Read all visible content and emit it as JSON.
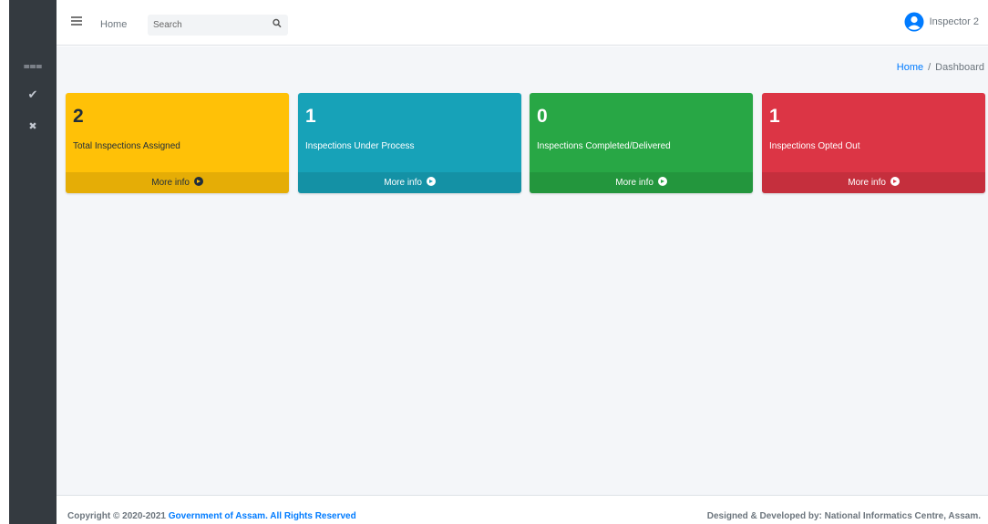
{
  "sidebar": {
    "items": [
      {
        "icon": "tasks-icon",
        "glyph": "⩶"
      },
      {
        "icon": "check-icon",
        "glyph": "✔"
      },
      {
        "icon": "times-icon",
        "glyph": "✖"
      }
    ]
  },
  "topbar": {
    "home_label": "Home",
    "search_placeholder": "Search",
    "user_name": "Inspector 2"
  },
  "breadcrumb": {
    "home": "Home",
    "separator": "/",
    "current": "Dashboard"
  },
  "cards": [
    {
      "value": "2",
      "label": "Total Inspections Assigned",
      "more": "More info",
      "color": "#ffc107"
    },
    {
      "value": "1",
      "label": "Inspections Under Process",
      "more": "More info",
      "color": "#17a2b8"
    },
    {
      "value": "0",
      "label": "Inspections Completed/Delivered",
      "more": "More info",
      "color": "#28a745"
    },
    {
      "value": "1",
      "label": "Inspections Opted Out",
      "more": "More info",
      "color": "#dc3545"
    }
  ],
  "footer": {
    "copyright_prefix": "Copyright © 2020-2021 ",
    "copyright_link": "Government of Assam. All Rights Reserved",
    "developer": "Designed & Developed by: National Informatics Centre, Assam."
  },
  "colors": {
    "sidebar_bg": "#343a40",
    "content_bg": "#f4f6f9",
    "link": "#007bff"
  }
}
